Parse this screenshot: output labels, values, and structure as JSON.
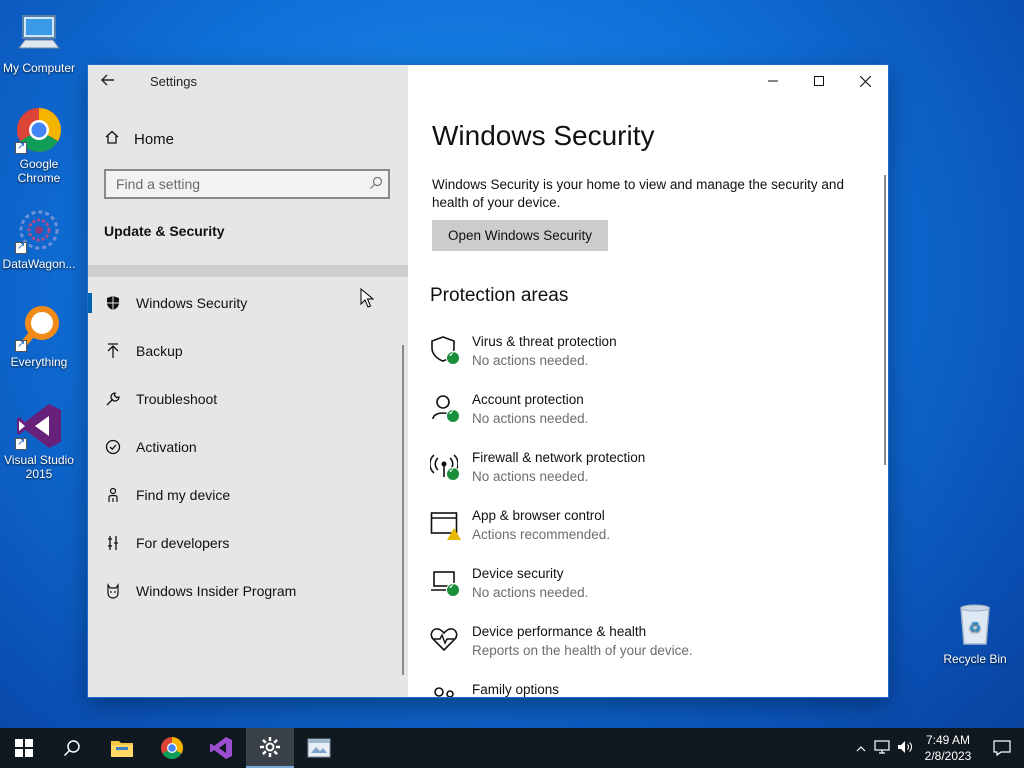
{
  "desktop": {
    "icons": [
      {
        "label": "My Computer"
      },
      {
        "label": "Google Chrome"
      },
      {
        "label": "DataWagon..."
      },
      {
        "label": "Everything"
      },
      {
        "label": "Visual Studio 2015"
      }
    ],
    "recycle_bin": "Recycle Bin"
  },
  "window": {
    "title": "Settings",
    "controls": {
      "minimize": "—",
      "maximize": "☐",
      "close": "✕"
    }
  },
  "sidebar": {
    "home": "Home",
    "search_placeholder": "Find a setting",
    "section": "Update & Security",
    "items": [
      {
        "label": "Windows Security",
        "icon": "shield-icon",
        "active": true
      },
      {
        "label": "Backup",
        "icon": "backup-icon"
      },
      {
        "label": "Troubleshoot",
        "icon": "wrench-icon"
      },
      {
        "label": "Activation",
        "icon": "activation-icon"
      },
      {
        "label": "Find my device",
        "icon": "person-location-icon"
      },
      {
        "label": "For developers",
        "icon": "developer-icon"
      },
      {
        "label": "Windows Insider Program",
        "icon": "insider-cat-icon"
      }
    ]
  },
  "main": {
    "title": "Windows Security",
    "description": "Windows Security is your home to view and manage the security and health of your device.",
    "open_button": "Open Windows Security",
    "section_title": "Protection areas",
    "areas": [
      {
        "title": "Virus & threat protection",
        "status": "No actions needed.",
        "icon": "shield-icon",
        "badge": "ok"
      },
      {
        "title": "Account protection",
        "status": "No actions needed.",
        "icon": "person-icon",
        "badge": "ok"
      },
      {
        "title": "Firewall & network protection",
        "status": "No actions needed.",
        "icon": "antenna-icon",
        "badge": "ok"
      },
      {
        "title": "App & browser control",
        "status": "Actions recommended.",
        "icon": "browser-icon",
        "badge": "warning"
      },
      {
        "title": "Device security",
        "status": "No actions needed.",
        "icon": "laptop-icon",
        "badge": "ok"
      },
      {
        "title": "Device performance & health",
        "status": "Reports on the health of your device.",
        "icon": "heart-icon",
        "badge": "none"
      },
      {
        "title": "Family options",
        "status": "",
        "icon": "family-icon",
        "badge": "none"
      }
    ]
  },
  "taskbar": {
    "time": "7:49 AM",
    "date": "2/8/2023"
  },
  "colors": {
    "accent": "#0063b1",
    "ok": "#1a8f3c",
    "warning": "#e7b900"
  }
}
